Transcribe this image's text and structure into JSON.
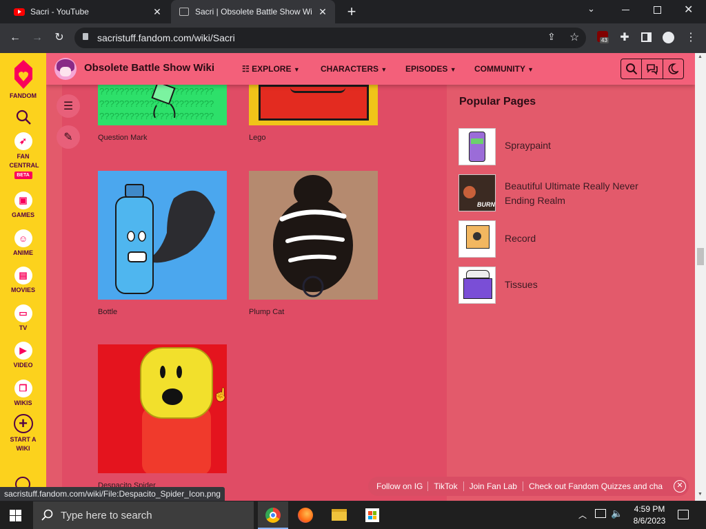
{
  "browser": {
    "tabs": [
      {
        "title": "Sacri - YouTube"
      },
      {
        "title": "Sacri | Obsolete Battle Show Wiki"
      }
    ],
    "url": "sacristuff.fandom.com/wiki/Sacri",
    "extension_badge": "43",
    "status_url": "sacristuff.fandom.com/wiki/File:Despacito_Spider_Icon.png"
  },
  "fandom_nav": {
    "brand": "FANDOM",
    "items": [
      {
        "label": "FAN CENTRAL",
        "badge": "BETA",
        "icon": "rocket-icon"
      },
      {
        "label": "GAMES",
        "icon": "gamepad-icon"
      },
      {
        "label": "ANIME",
        "icon": "anime-face-icon"
      },
      {
        "label": "MOVIES",
        "icon": "film-icon"
      },
      {
        "label": "TV",
        "icon": "tv-icon"
      },
      {
        "label": "VIDEO",
        "icon": "play-icon"
      },
      {
        "label": "WIKIS",
        "icon": "book-icon"
      },
      {
        "label": "START A WIKI",
        "icon": "plus-circle-icon"
      }
    ]
  },
  "wiki": {
    "name": "Obsolete Battle Show Wiki",
    "nav": [
      {
        "label": "EXPLORE"
      },
      {
        "label": "CHARACTERS"
      },
      {
        "label": "EPISODES"
      },
      {
        "label": "COMMUNITY"
      }
    ]
  },
  "gallery": [
    {
      "caption": "Question Mark"
    },
    {
      "caption": "Lego"
    },
    {
      "caption": "Bottle"
    },
    {
      "caption": "Plump Cat"
    },
    {
      "caption": "Despacito Spider"
    }
  ],
  "popular": {
    "heading": "Popular Pages",
    "items": [
      {
        "label": "Spraypaint"
      },
      {
        "label": "Beautiful Ultimate Really Never Ending Realm",
        "thumb_text": "BURN"
      },
      {
        "label": "Record"
      },
      {
        "label": "Tissues"
      }
    ]
  },
  "footer_links": [
    "Follow on IG",
    "TikTok",
    "Join Fan Lab",
    "Check out Fandom Quizzes and cha"
  ],
  "taskbar": {
    "search_placeholder": "Type here to search",
    "time": "4:59 PM",
    "date": "8/6/2023"
  },
  "colors": {
    "wiki_bg": "#e35a6b",
    "header_bg": "#f3607a",
    "fandom_yellow": "#fcd21d",
    "fandom_pink": "#fa005a"
  }
}
